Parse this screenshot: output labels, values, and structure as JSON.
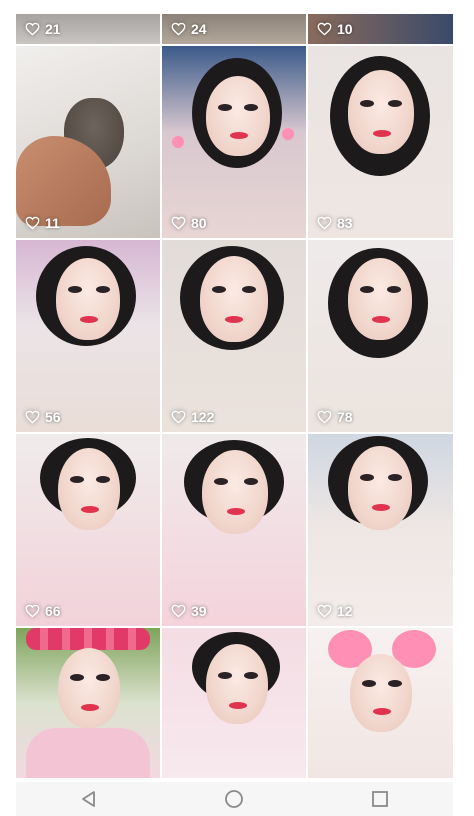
{
  "gallery": {
    "tiles": [
      {
        "likes": "21"
      },
      {
        "likes": "24"
      },
      {
        "likes": "10"
      },
      {
        "likes": "11"
      },
      {
        "likes": "80"
      },
      {
        "likes": "83"
      },
      {
        "likes": "56"
      },
      {
        "likes": "122"
      },
      {
        "likes": "78"
      },
      {
        "likes": "66"
      },
      {
        "likes": "39"
      },
      {
        "likes": "12"
      },
      {
        "likes": ""
      },
      {
        "likes": ""
      },
      {
        "likes": ""
      }
    ]
  },
  "icons": {
    "like": "heart-outline-icon",
    "back": "triangle-back-icon",
    "home": "circle-home-icon",
    "recents": "square-recents-icon"
  },
  "colors": {
    "like_text": "#ffffff",
    "navbar_bg": "#f6f6f6",
    "nav_icon": "#8a8a8a"
  }
}
